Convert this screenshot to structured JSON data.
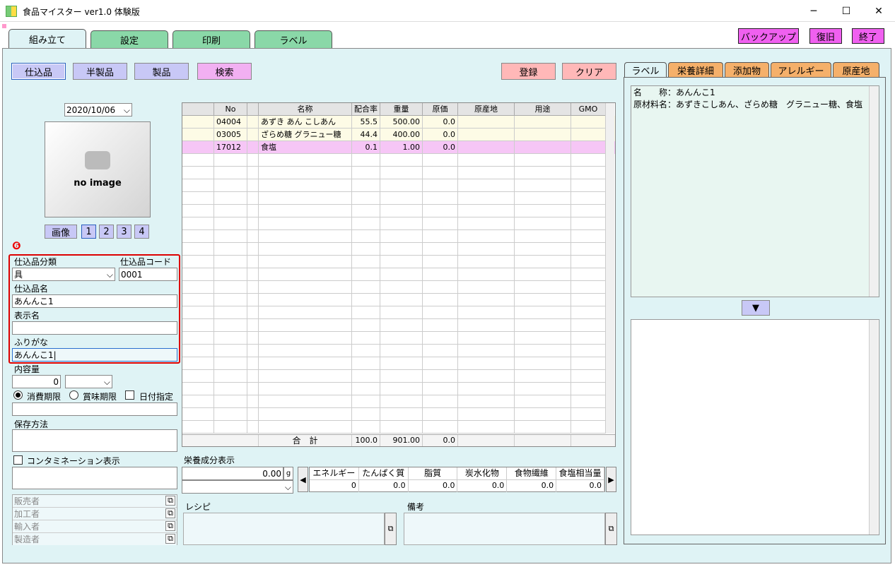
{
  "window": {
    "title": "食品マイスター ver1.0 体験版",
    "minimize": "─",
    "maximize": "☐",
    "close": "✕"
  },
  "tabs": [
    "組み立て",
    "設定",
    "印刷",
    "ラベル"
  ],
  "top_buttons": {
    "backup": "バックアップ",
    "restore": "復旧",
    "exit": "終了"
  },
  "type_buttons": [
    "仕込品",
    "半製品",
    "製品",
    "検索"
  ],
  "actions": {
    "register": "登録",
    "clear": "クリア"
  },
  "date": "2020/10/06",
  "image": {
    "placeholder": "no image",
    "button": "画像",
    "pages": [
      "1",
      "2",
      "3",
      "4"
    ]
  },
  "badge": "❻",
  "form": {
    "category_label": "仕込品分類",
    "category_value": "具",
    "code_label": "仕込品コード",
    "code_value": "0001",
    "name_label": "仕込品名",
    "name_value": "あんんこ1",
    "display_label": "表示名",
    "display_value": "",
    "furigana_label": "ふりがな",
    "furigana_value": "あんんこ1|",
    "content_label": "内容量",
    "content_value": "0",
    "expiry": "消費期限",
    "best_before": "賞味期限",
    "date_spec": "日付指定",
    "storage_label": "保存方法",
    "contamination": "コンタミネーション表示",
    "parties": [
      "販売者",
      "加工者",
      "輸入者",
      "製造者"
    ]
  },
  "table": {
    "headers": [
      "No",
      "名称",
      "配合率",
      "重量",
      "原価",
      "原産地",
      "用途",
      "GMO"
    ],
    "rows": [
      {
        "no": "04004",
        "name": "あずき あん こしあん",
        "rate": "55.5",
        "weight": "500.00",
        "cost": "0.0",
        "color": "#fdfbe6"
      },
      {
        "no": "03005",
        "name": "ざらめ糖 グラニュー糖",
        "rate": "44.4",
        "weight": "400.00",
        "cost": "0.0",
        "color": "#fdfbe6"
      },
      {
        "no": "17012",
        "name": "食塩",
        "rate": "0.1",
        "weight": "1.00",
        "cost": "0.0",
        "color": "#f6c6f6"
      }
    ],
    "total_label": "合　計",
    "total_rate": "100.0",
    "total_weight": "901.00",
    "total_cost": "0.0"
  },
  "nutrition": {
    "label": "栄養成分表示",
    "amount": "0.00",
    "unit": "g",
    "headers": [
      "エネルギー",
      "たんぱく質",
      "脂質",
      "炭水化物",
      "食物繊維",
      "食塩相当量"
    ],
    "values": [
      "0",
      "0.0",
      "0.0",
      "0.0",
      "0.0",
      "0.0"
    ]
  },
  "recipe_label": "レシピ",
  "notes_label": "備考",
  "right_tabs": [
    "ラベル",
    "栄養詳細",
    "添加物",
    "アレルギー",
    "原産地"
  ],
  "label_text": {
    "line1": "名　　称：あんんこ1",
    "line2": "原材料名：あずきこしあん、ざらめ糖　グラニュー糖、食塩"
  },
  "arrow_down": "▼"
}
